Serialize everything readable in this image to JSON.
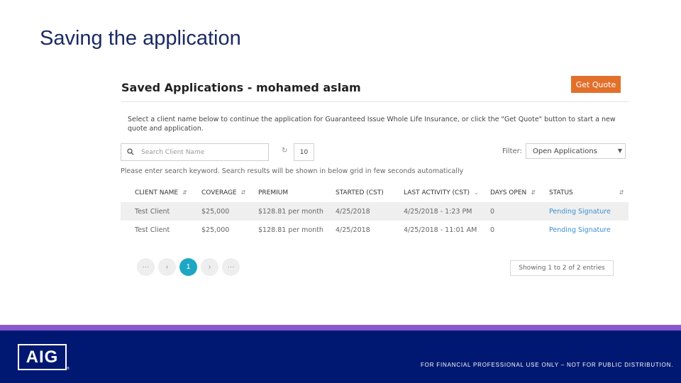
{
  "slide": {
    "title": "Saving the application"
  },
  "app": {
    "heading": "Saved Applications - mohamed aslam",
    "get_quote_label": "Get Quote",
    "intro": "Select a client name below to continue the application for Guaranteed Issue Whole Life Insurance, or click the \"Get Quote\" button to start a new quote and application.",
    "search": {
      "placeholder": "Search Client Name",
      "value": ""
    },
    "page_size": "10",
    "filter": {
      "label": "Filter:",
      "selected": "Open Applications"
    },
    "hint": "Please enter search keyword. Search results will be shown in below grid in few seconds automatically",
    "table": {
      "headers": [
        "CLIENT NAME",
        "COVERAGE",
        "PREMIUM",
        "STARTED (CST)",
        "LAST ACTIVITY (CST)",
        "DAYS OPEN",
        "STATUS"
      ],
      "rows": [
        [
          "Test Client",
          "$25,000",
          "$128.81 per month",
          "4/25/2018",
          "4/25/2018 - 1:23 PM",
          "0",
          "Pending Signature"
        ],
        [
          "Test Client",
          "$25,000",
          "$128.81 per month",
          "4/25/2018",
          "4/25/2018 - 11:01 AM",
          "0",
          "Pending Signature"
        ]
      ]
    },
    "pagination": {
      "first": "···",
      "prev": "‹",
      "current": "1",
      "next": "›",
      "last": "···"
    },
    "showing": "Showing 1 to 2 of 2 entries"
  },
  "footer": {
    "logo": "AIG",
    "registered": "®",
    "disclaimer": "FOR FINANCIAL PROFESSIONAL USE ONLY – NOT FOR PUBLIC DISTRIBUTION."
  },
  "colors": {
    "title": "#1b2a63",
    "accent": "#e2702b",
    "active_page": "#1ea7c5",
    "band": "#8b57cc",
    "footer": "#001871",
    "status": "#3d8fd1"
  },
  "icons": {
    "search": "search-icon",
    "refresh": "refresh-icon",
    "sort": "sort-icon",
    "dropdown": "caret-down-icon"
  }
}
